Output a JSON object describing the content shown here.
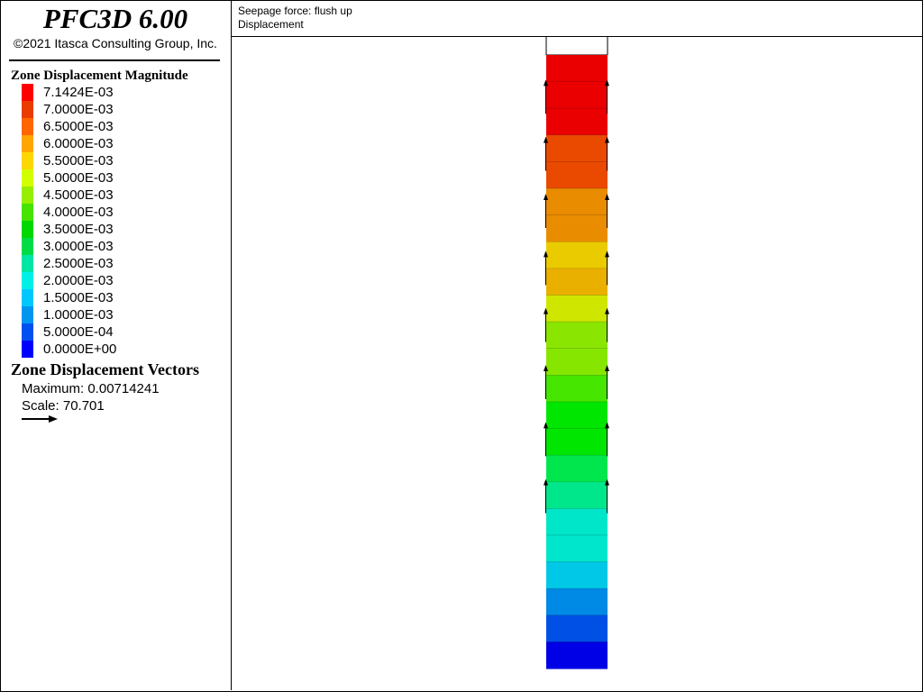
{
  "app": {
    "title": "PFC3D 6.00",
    "copyright": "©2021 Itasca Consulting Group, Inc."
  },
  "legend": {
    "title": "Zone Displacement Magnitude",
    "entries": [
      {
        "label": "7.1424E-03",
        "color": "#ff0000"
      },
      {
        "label": "7.0000E-03",
        "color": "#ea3c00"
      },
      {
        "label": "6.5000E-03",
        "color": "#ff6600"
      },
      {
        "label": "6.0000E-03",
        "color": "#ffa500"
      },
      {
        "label": "5.5000E-03",
        "color": "#ffd700"
      },
      {
        "label": "5.0000E-03",
        "color": "#d2ff00"
      },
      {
        "label": "4.5000E-03",
        "color": "#96ee00"
      },
      {
        "label": "4.0000E-03",
        "color": "#46e400"
      },
      {
        "label": "3.5000E-03",
        "color": "#00d800"
      },
      {
        "label": "3.0000E-03",
        "color": "#00dc46"
      },
      {
        "label": "2.5000E-03",
        "color": "#00e6a5"
      },
      {
        "label": "2.0000E-03",
        "color": "#00f0e6"
      },
      {
        "label": "1.5000E-03",
        "color": "#00c8ff"
      },
      {
        "label": "1.0000E-03",
        "color": "#0096f0"
      },
      {
        "label": "5.0000E-04",
        "color": "#0050f0"
      },
      {
        "label": "0.0000E+00",
        "color": "#0000ff"
      }
    ]
  },
  "vectors": {
    "title": "Zone Displacement Vectors",
    "maximum": "Maximum: 0.00714241",
    "scale": "Scale: 70.701"
  },
  "plot": {
    "line1": "Seepage force:  flush up",
    "line2": "Displacement"
  },
  "column_bands": [
    {
      "color": "#ea0000"
    },
    {
      "color": "#ea0000"
    },
    {
      "color": "#ea0000"
    },
    {
      "color": "#ea4a00"
    },
    {
      "color": "#ea4a00"
    },
    {
      "color": "#ea8c00"
    },
    {
      "color": "#ea8c00"
    },
    {
      "color": "#eacb00"
    },
    {
      "color": "#eab000"
    },
    {
      "color": "#cfe600"
    },
    {
      "color": "#8ae600"
    },
    {
      "color": "#86e600"
    },
    {
      "color": "#46e600"
    },
    {
      "color": "#00e600"
    },
    {
      "color": "#00e600"
    },
    {
      "color": "#00e64c"
    },
    {
      "color": "#00e68a"
    },
    {
      "color": "#00e6c8"
    },
    {
      "color": "#00e6cc"
    },
    {
      "color": "#00c8e6"
    },
    {
      "color": "#008ae6"
    },
    {
      "color": "#0050e6"
    },
    {
      "color": "#0000e6"
    }
  ]
}
